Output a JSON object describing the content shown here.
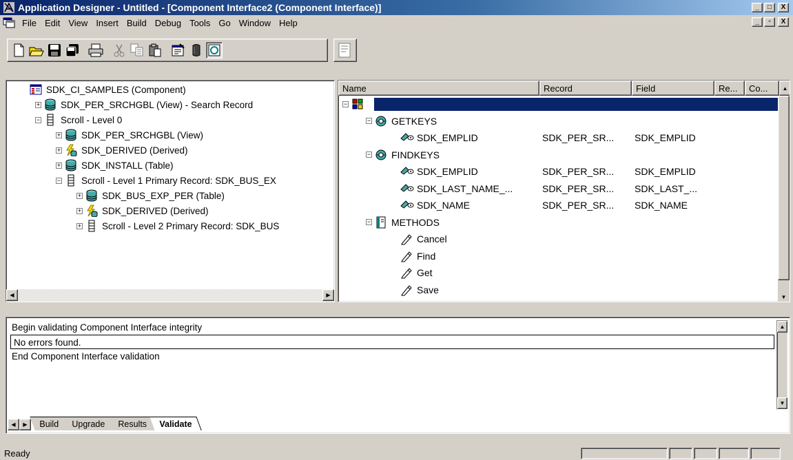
{
  "window": {
    "title": "Application Designer - Untitled - [Component Interface2 (Component Interface)]",
    "controls": [
      "_",
      "□",
      "X"
    ]
  },
  "menu": {
    "items": [
      "File",
      "Edit",
      "View",
      "Insert",
      "Build",
      "Debug",
      "Tools",
      "Go",
      "Window",
      "Help"
    ],
    "mdi_controls": [
      "_",
      "▫",
      "X"
    ]
  },
  "toolbar": {
    "buttons": [
      "new-icon",
      "open-icon",
      "save-icon",
      "save-all-icon",
      "print-icon",
      "cut-icon",
      "copy-icon",
      "paste-icon",
      "properties-icon",
      "project-icon",
      "view-definition-icon",
      "component-icon"
    ]
  },
  "left_tree": {
    "items": [
      {
        "label": "SDK_CI_SAMPLES (Component)",
        "icon": "component-icon",
        "level": 0,
        "toggle": ""
      },
      {
        "label": "SDK_PER_SRCHGBL (View) - Search Record",
        "icon": "database-icon",
        "level": 0,
        "toggle": "+"
      },
      {
        "label": "Scroll - Level 0",
        "icon": "scroll-icon",
        "level": 0,
        "toggle": "−"
      },
      {
        "label": "SDK_PER_SRCHGBL (View)",
        "icon": "database-icon",
        "level": 1,
        "toggle": "+"
      },
      {
        "label": "SDK_DERIVED (Derived)",
        "icon": "derived-icon",
        "level": 1,
        "toggle": "+"
      },
      {
        "label": "SDK_INSTALL (Table)",
        "icon": "database-icon",
        "level": 1,
        "toggle": "+"
      },
      {
        "label": "Scroll - Level 1  Primary Record: SDK_BUS_EX",
        "icon": "scroll-icon",
        "level": 1,
        "toggle": "−"
      },
      {
        "label": "SDK_BUS_EXP_PER (Table)",
        "icon": "database-icon",
        "level": 2,
        "toggle": "+"
      },
      {
        "label": "SDK_DERIVED (Derived)",
        "icon": "derived-icon",
        "level": 2,
        "toggle": "+"
      },
      {
        "label": "Scroll - Level 2  Primary Record: SDK_BUS",
        "icon": "scroll-icon",
        "level": 2,
        "toggle": "+"
      }
    ]
  },
  "right_grid": {
    "columns": [
      "Name",
      "Record",
      "Field",
      "Re...",
      "Co..."
    ],
    "rows": [
      {
        "name": "",
        "record": "",
        "field": "",
        "icon": "ci-icon",
        "level": 0,
        "toggle": "−",
        "selected": true
      },
      {
        "name": "GETKEYS",
        "record": "",
        "field": "",
        "icon": "keys-group-icon",
        "level": 1,
        "toggle": "−"
      },
      {
        "name": "SDK_EMPLID",
        "record": "SDK_PER_SR...",
        "field": "SDK_EMPLID",
        "icon": "key-icon",
        "level": 2,
        "toggle": ""
      },
      {
        "name": "FINDKEYS",
        "record": "",
        "field": "",
        "icon": "keys-group-icon",
        "level": 1,
        "toggle": "−"
      },
      {
        "name": "SDK_EMPLID",
        "record": "SDK_PER_SR...",
        "field": "SDK_EMPLID",
        "icon": "key-icon",
        "level": 2,
        "toggle": ""
      },
      {
        "name": "SDK_LAST_NAME_...",
        "record": "SDK_PER_SR...",
        "field": "SDK_LAST_...",
        "icon": "key-icon",
        "level": 2,
        "toggle": ""
      },
      {
        "name": "SDK_NAME",
        "record": "SDK_PER_SR...",
        "field": "SDK_NAME",
        "icon": "key-icon",
        "level": 2,
        "toggle": ""
      },
      {
        "name": "METHODS",
        "record": "",
        "field": "",
        "icon": "methods-icon",
        "level": 1,
        "toggle": "−"
      },
      {
        "name": "Cancel",
        "record": "",
        "field": "",
        "icon": "method-icon",
        "level": 2,
        "toggle": ""
      },
      {
        "name": "Find",
        "record": "",
        "field": "",
        "icon": "method-icon",
        "level": 2,
        "toggle": ""
      },
      {
        "name": "Get",
        "record": "",
        "field": "",
        "icon": "method-icon",
        "level": 2,
        "toggle": ""
      },
      {
        "name": "Save",
        "record": "",
        "field": "",
        "icon": "method-icon",
        "level": 2,
        "toggle": ""
      }
    ]
  },
  "output": {
    "lines": [
      {
        "text": "Begin validating Component Interface integrity",
        "selected": false
      },
      {
        "text": "No errors found.",
        "selected": true
      },
      {
        "text": "End Component Interface validation",
        "selected": false
      }
    ],
    "tabs": [
      {
        "label": "Build",
        "active": false
      },
      {
        "label": "Upgrade",
        "active": false
      },
      {
        "label": "Results",
        "active": false
      },
      {
        "label": "Validate",
        "active": true
      }
    ]
  },
  "status": {
    "text": "Ready"
  }
}
